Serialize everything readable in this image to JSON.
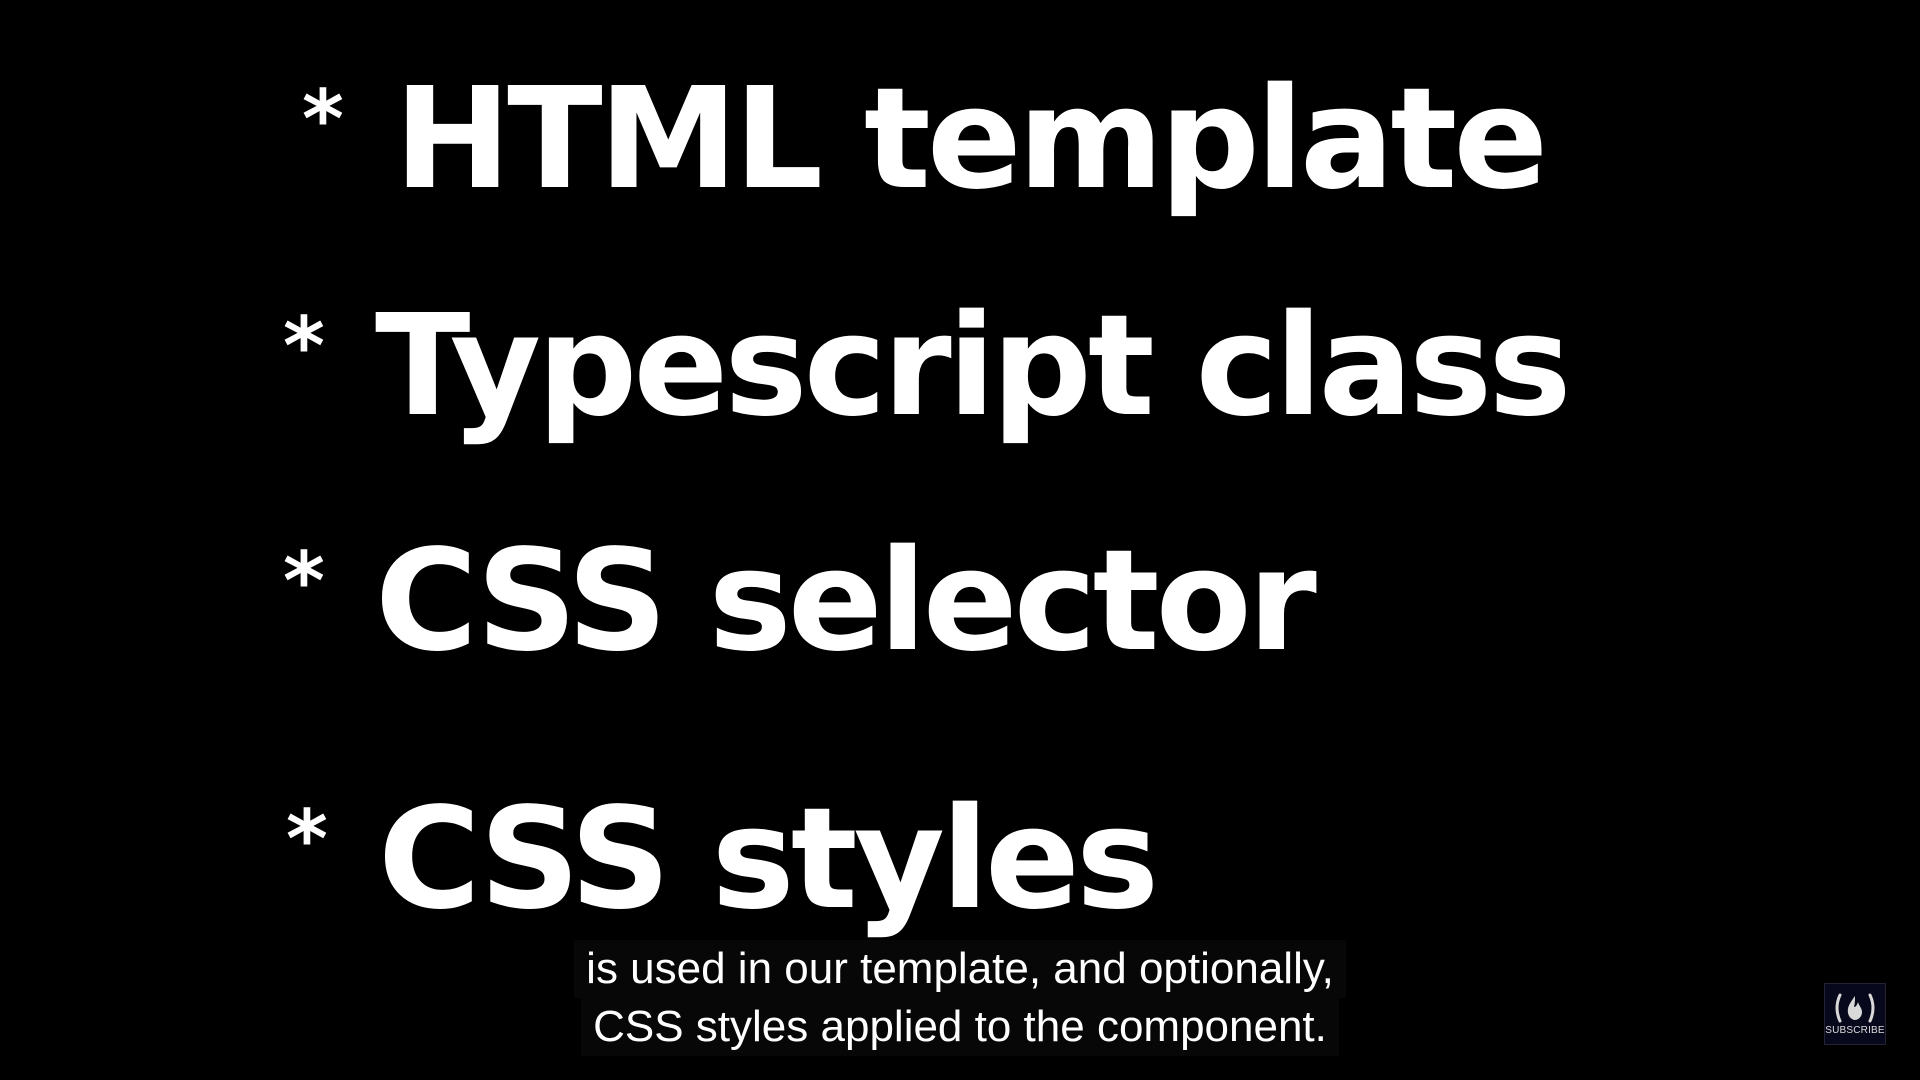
{
  "slide": {
    "bullet_marker": "*",
    "items": [
      {
        "label": "HTML template"
      },
      {
        "label": "Typescript class"
      },
      {
        "label": "CSS selector"
      },
      {
        "label": "CSS styles"
      }
    ]
  },
  "captions": {
    "line1": "is used in our template, and optionally,",
    "line2": "CSS styles applied to the component."
  },
  "watermark": {
    "icon": "freecodecamp-flame-icon",
    "label": "SUBSCRIBE"
  },
  "colors": {
    "background": "#000000",
    "text": "#ffffff",
    "caption_bg": "#080808"
  }
}
